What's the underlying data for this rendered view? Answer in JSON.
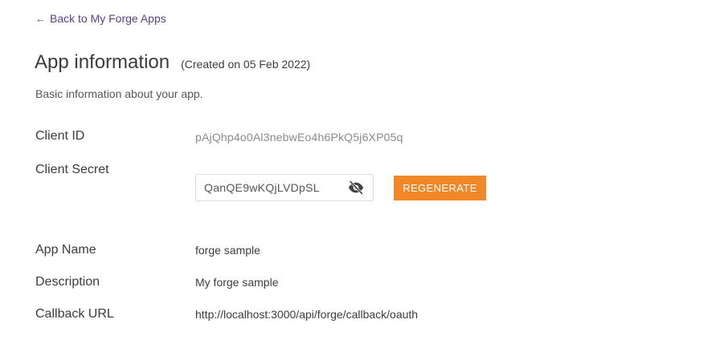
{
  "nav": {
    "back_link": "Back to My Forge Apps"
  },
  "header": {
    "title": "App information",
    "created": "(Created on 05 Feb 2022)",
    "subtitle": "Basic information about your app."
  },
  "credentials": {
    "client_id_label": "Client ID",
    "client_id_value": "pAjQhp4o0Al3nebwEo4h6PkQ5j6XP05q",
    "client_secret_label": "Client Secret",
    "client_secret_value": "QanQE9wKQjLVDpSL",
    "visibility_icon": "eye-off-icon",
    "regenerate_label": "REGENERATE"
  },
  "app": {
    "name_label": "App Name",
    "name_value": "forge sample",
    "description_label": "Description",
    "description_value": "My forge sample",
    "callback_label": "Callback URL",
    "callback_value": "http://localhost:3000/api/forge/callback/oauth"
  },
  "colors": {
    "link": "#5a3f8c",
    "accent": "#f0882a"
  }
}
